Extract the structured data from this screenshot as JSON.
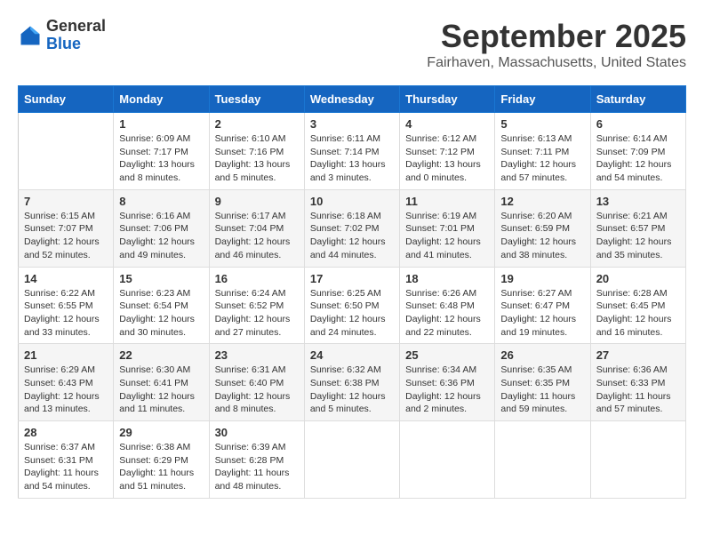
{
  "logo": {
    "general": "General",
    "blue": "Blue"
  },
  "title": "September 2025",
  "location": "Fairhaven, Massachusetts, United States",
  "days_of_week": [
    "Sunday",
    "Monday",
    "Tuesday",
    "Wednesday",
    "Thursday",
    "Friday",
    "Saturday"
  ],
  "weeks": [
    [
      {
        "day": "",
        "info": ""
      },
      {
        "day": "1",
        "info": "Sunrise: 6:09 AM\nSunset: 7:17 PM\nDaylight: 13 hours\nand 8 minutes."
      },
      {
        "day": "2",
        "info": "Sunrise: 6:10 AM\nSunset: 7:16 PM\nDaylight: 13 hours\nand 5 minutes."
      },
      {
        "day": "3",
        "info": "Sunrise: 6:11 AM\nSunset: 7:14 PM\nDaylight: 13 hours\nand 3 minutes."
      },
      {
        "day": "4",
        "info": "Sunrise: 6:12 AM\nSunset: 7:12 PM\nDaylight: 13 hours\nand 0 minutes."
      },
      {
        "day": "5",
        "info": "Sunrise: 6:13 AM\nSunset: 7:11 PM\nDaylight: 12 hours\nand 57 minutes."
      },
      {
        "day": "6",
        "info": "Sunrise: 6:14 AM\nSunset: 7:09 PM\nDaylight: 12 hours\nand 54 minutes."
      }
    ],
    [
      {
        "day": "7",
        "info": "Sunrise: 6:15 AM\nSunset: 7:07 PM\nDaylight: 12 hours\nand 52 minutes."
      },
      {
        "day": "8",
        "info": "Sunrise: 6:16 AM\nSunset: 7:06 PM\nDaylight: 12 hours\nand 49 minutes."
      },
      {
        "day": "9",
        "info": "Sunrise: 6:17 AM\nSunset: 7:04 PM\nDaylight: 12 hours\nand 46 minutes."
      },
      {
        "day": "10",
        "info": "Sunrise: 6:18 AM\nSunset: 7:02 PM\nDaylight: 12 hours\nand 44 minutes."
      },
      {
        "day": "11",
        "info": "Sunrise: 6:19 AM\nSunset: 7:01 PM\nDaylight: 12 hours\nand 41 minutes."
      },
      {
        "day": "12",
        "info": "Sunrise: 6:20 AM\nSunset: 6:59 PM\nDaylight: 12 hours\nand 38 minutes."
      },
      {
        "day": "13",
        "info": "Sunrise: 6:21 AM\nSunset: 6:57 PM\nDaylight: 12 hours\nand 35 minutes."
      }
    ],
    [
      {
        "day": "14",
        "info": "Sunrise: 6:22 AM\nSunset: 6:55 PM\nDaylight: 12 hours\nand 33 minutes."
      },
      {
        "day": "15",
        "info": "Sunrise: 6:23 AM\nSunset: 6:54 PM\nDaylight: 12 hours\nand 30 minutes."
      },
      {
        "day": "16",
        "info": "Sunrise: 6:24 AM\nSunset: 6:52 PM\nDaylight: 12 hours\nand 27 minutes."
      },
      {
        "day": "17",
        "info": "Sunrise: 6:25 AM\nSunset: 6:50 PM\nDaylight: 12 hours\nand 24 minutes."
      },
      {
        "day": "18",
        "info": "Sunrise: 6:26 AM\nSunset: 6:48 PM\nDaylight: 12 hours\nand 22 minutes."
      },
      {
        "day": "19",
        "info": "Sunrise: 6:27 AM\nSunset: 6:47 PM\nDaylight: 12 hours\nand 19 minutes."
      },
      {
        "day": "20",
        "info": "Sunrise: 6:28 AM\nSunset: 6:45 PM\nDaylight: 12 hours\nand 16 minutes."
      }
    ],
    [
      {
        "day": "21",
        "info": "Sunrise: 6:29 AM\nSunset: 6:43 PM\nDaylight: 12 hours\nand 13 minutes."
      },
      {
        "day": "22",
        "info": "Sunrise: 6:30 AM\nSunset: 6:41 PM\nDaylight: 12 hours\nand 11 minutes."
      },
      {
        "day": "23",
        "info": "Sunrise: 6:31 AM\nSunset: 6:40 PM\nDaylight: 12 hours\nand 8 minutes."
      },
      {
        "day": "24",
        "info": "Sunrise: 6:32 AM\nSunset: 6:38 PM\nDaylight: 12 hours\nand 5 minutes."
      },
      {
        "day": "25",
        "info": "Sunrise: 6:34 AM\nSunset: 6:36 PM\nDaylight: 12 hours\nand 2 minutes."
      },
      {
        "day": "26",
        "info": "Sunrise: 6:35 AM\nSunset: 6:35 PM\nDaylight: 11 hours\nand 59 minutes."
      },
      {
        "day": "27",
        "info": "Sunrise: 6:36 AM\nSunset: 6:33 PM\nDaylight: 11 hours\nand 57 minutes."
      }
    ],
    [
      {
        "day": "28",
        "info": "Sunrise: 6:37 AM\nSunset: 6:31 PM\nDaylight: 11 hours\nand 54 minutes."
      },
      {
        "day": "29",
        "info": "Sunrise: 6:38 AM\nSunset: 6:29 PM\nDaylight: 11 hours\nand 51 minutes."
      },
      {
        "day": "30",
        "info": "Sunrise: 6:39 AM\nSunset: 6:28 PM\nDaylight: 11 hours\nand 48 minutes."
      },
      {
        "day": "",
        "info": ""
      },
      {
        "day": "",
        "info": ""
      },
      {
        "day": "",
        "info": ""
      },
      {
        "day": "",
        "info": ""
      }
    ]
  ]
}
